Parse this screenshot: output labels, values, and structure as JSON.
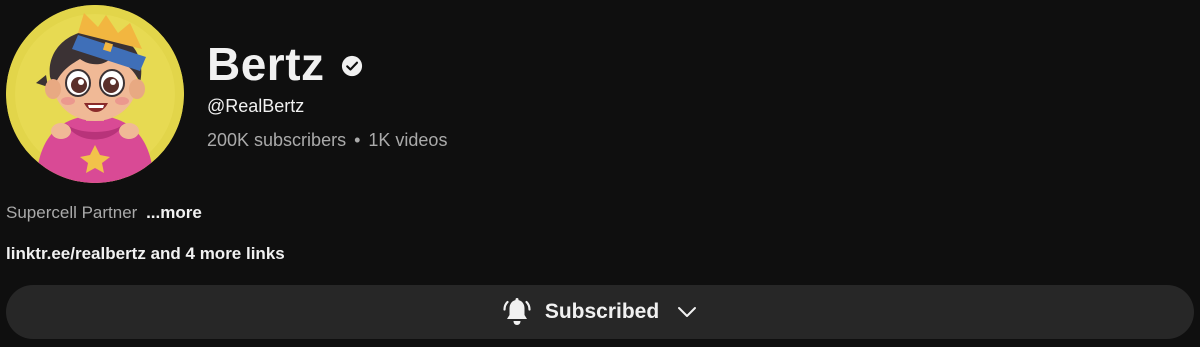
{
  "channel": {
    "name": "Bertz",
    "handle": "@RealBertz",
    "subscribers": "200K subscribers",
    "separator": "•",
    "videos": "1K videos",
    "verified": true
  },
  "description": {
    "text": "Supercell Partner",
    "more_label": "...more"
  },
  "links": {
    "text": "linktr.ee/realbertz and 4 more links"
  },
  "subscribe": {
    "label": "Subscribed",
    "icon": "bell-ringing-icon",
    "dropdown_icon": "chevron-down-icon"
  },
  "colors": {
    "background": "#0f0f0f",
    "button_bg": "#272727",
    "primary_text": "#f1f1f1",
    "secondary_text": "#aaaaaa",
    "avatar_bg": "#e5d84e"
  }
}
